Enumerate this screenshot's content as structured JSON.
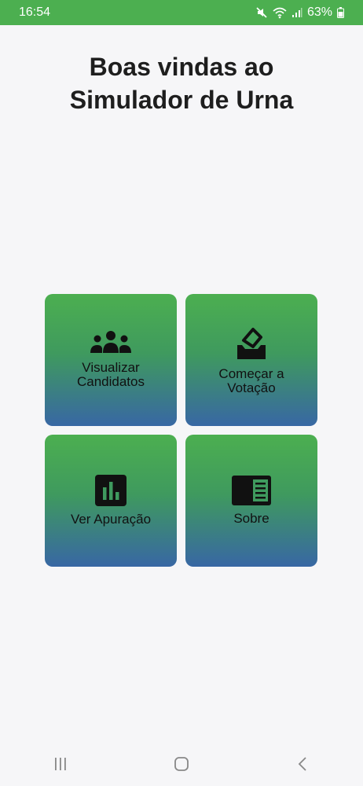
{
  "status_bar": {
    "time": "16:54",
    "battery": "63%"
  },
  "title": {
    "line1": "Boas vindas ao",
    "line2": "Simulador de Urna"
  },
  "menu": {
    "candidatos_label": "Visualizar\nCandidatos",
    "votacao_label": "Começar a\nVotação",
    "apuracao_label": "Ver Apuração",
    "sobre_label": "Sobre"
  },
  "colors": {
    "status_bar": "#4caf50",
    "card_top": "#4caf50",
    "card_bottom": "#3867a4",
    "background": "#f6f6f8"
  },
  "icons": {
    "candidatos": "people-group-icon",
    "votacao": "ballot-box-icon",
    "apuracao": "bar-chart-icon",
    "sobre": "article-icon"
  }
}
